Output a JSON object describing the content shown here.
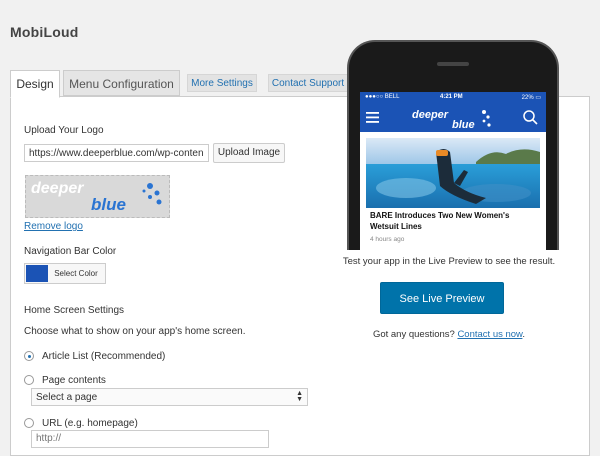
{
  "app": {
    "brand": "MobiLoud"
  },
  "tabs": {
    "design": "Design",
    "menu_configuration": "Menu Configuration",
    "more_settings": "More Settings",
    "contact_support": "Contact Support"
  },
  "logo": {
    "section_label": "Upload Your Logo",
    "url_value": "https://www.deeperblue.com/wp-conten",
    "upload_button": "Upload Image",
    "preview_line1": "deeper",
    "preview_line2": "blue",
    "remove_link": "Remove logo"
  },
  "nav_color": {
    "label": "Navigation Bar Color",
    "swatch_color": "#1b53b5",
    "select_button": "Select Color"
  },
  "home": {
    "heading": "Home Screen Settings",
    "description": "Choose what to show on your app's home screen.",
    "options": [
      {
        "label": "Article List (Recommended)",
        "selected": true
      },
      {
        "label": "Page contents",
        "selected": false
      },
      {
        "label": "URL (e.g. homepage)",
        "selected": false
      }
    ],
    "page_select_value": "Select a page",
    "url_placeholder": "http://"
  },
  "preview": {
    "status_carrier": "BELL",
    "status_time": "4:21 PM",
    "status_battery": "22%",
    "app_logo_line1": "deeper",
    "app_logo_line2": "blue",
    "article_title": "BARE Introduces Two New Women's Wetsuit Lines",
    "article_time": "4 hours ago",
    "test_text": "Test your app in the Live Preview to see the result.",
    "live_preview_button": "See Live Preview",
    "questions_text": "Got any questions?",
    "contact_link": "Contact us now",
    "questions_end": "."
  },
  "colors": {
    "accent": "#2271b1",
    "app_bar": "#1b53b5",
    "cta": "#0073aa"
  }
}
